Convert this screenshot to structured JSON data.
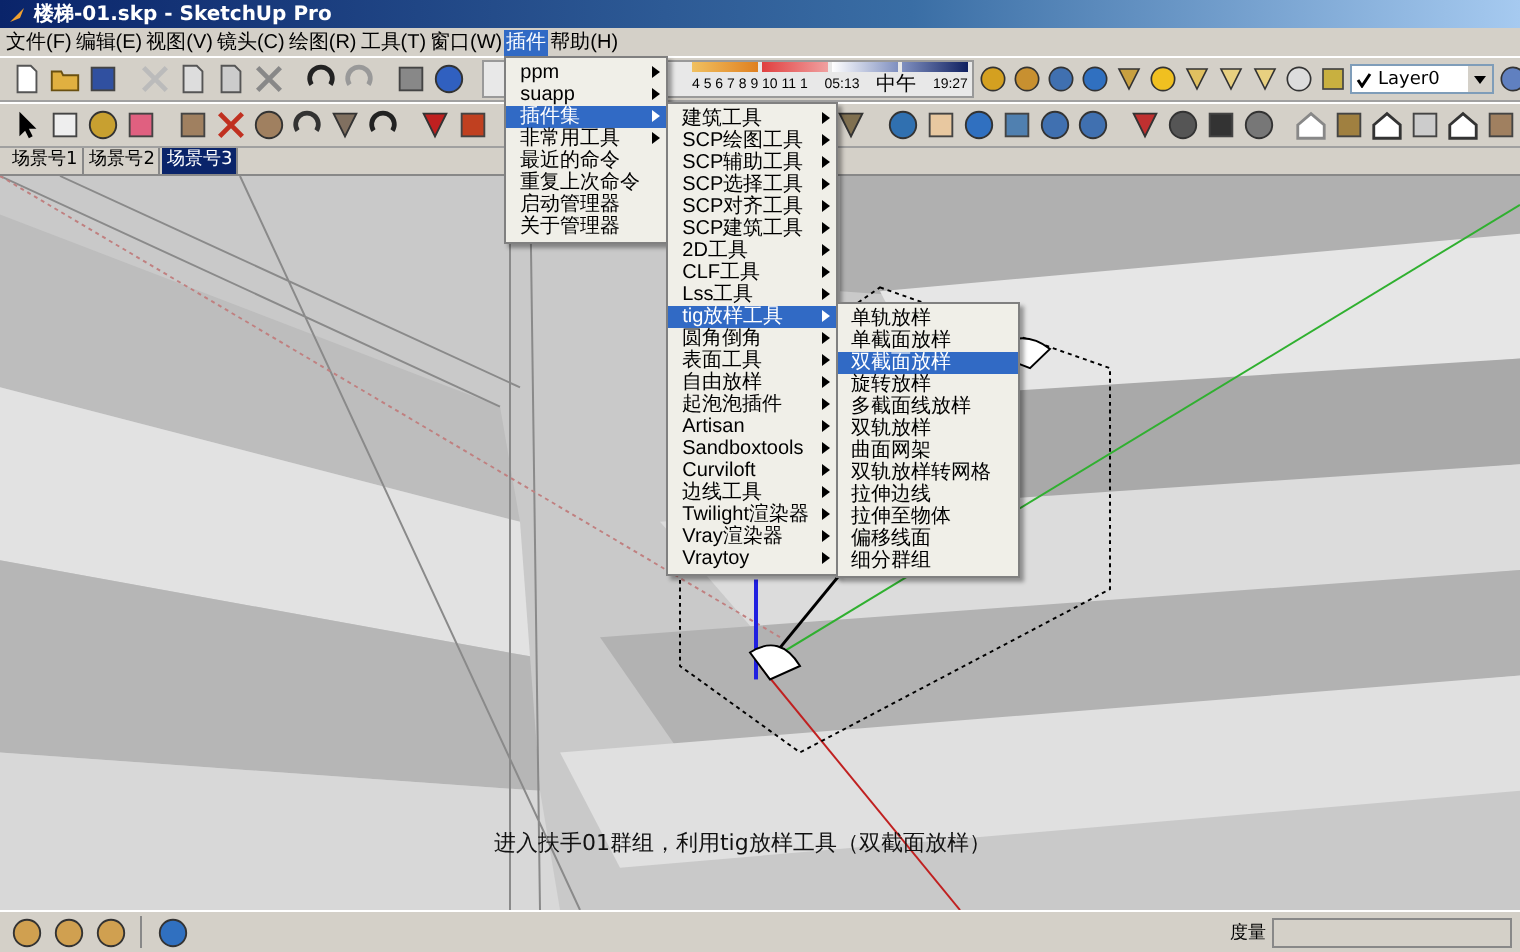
{
  "window": {
    "title": "楼梯-01.skp - SketchUp Pro"
  },
  "menu_bar": [
    {
      "label": "文件(F)",
      "selected": false
    },
    {
      "label": "编辑(E)",
      "selected": false
    },
    {
      "label": "视图(V)",
      "selected": false
    },
    {
      "label": "镜头(C)",
      "selected": false
    },
    {
      "label": "绘图(R)",
      "selected": false
    },
    {
      "label": "工具(T)",
      "selected": false
    },
    {
      "label": "窗口(W)",
      "selected": false
    },
    {
      "label": "插件",
      "selected": true
    },
    {
      "label": "帮助(H)",
      "selected": false
    }
  ],
  "shadow_bar": {
    "months": "4 5 6 7 8 9 10 11 1",
    "sunrise": "05:13",
    "noon": "中午",
    "sunset": "19:27"
  },
  "layer_select": {
    "value": "Layer0"
  },
  "scene_tabs": [
    {
      "label": "场景号1",
      "selected": false
    },
    {
      "label": "场景号2",
      "selected": false
    },
    {
      "label": "场景号3",
      "selected": true
    }
  ],
  "menus": [
    {
      "items": [
        {
          "label": "ppm",
          "submenu": true,
          "selected": false
        },
        {
          "label": "suapp",
          "submenu": true,
          "selected": false
        },
        {
          "label": "插件集",
          "submenu": true,
          "selected": true
        },
        {
          "label": "非常用工具",
          "submenu": true,
          "selected": false
        },
        {
          "label": "最近的命令",
          "submenu": false,
          "selected": false
        },
        {
          "label": "重复上次命令",
          "submenu": false,
          "selected": false
        },
        {
          "label": "启动管理器",
          "submenu": false,
          "selected": false
        },
        {
          "label": "关于管理器",
          "submenu": false,
          "selected": false
        }
      ]
    },
    {
      "items": [
        {
          "label": "建筑工具",
          "submenu": true,
          "selected": false
        },
        {
          "label": "SCP绘图工具",
          "submenu": true,
          "selected": false
        },
        {
          "label": "SCP辅助工具",
          "submenu": true,
          "selected": false
        },
        {
          "label": "SCP选择工具",
          "submenu": true,
          "selected": false
        },
        {
          "label": "SCP对齐工具",
          "submenu": true,
          "selected": false
        },
        {
          "label": "SCP建筑工具",
          "submenu": true,
          "selected": false
        },
        {
          "label": "2D工具",
          "submenu": true,
          "selected": false
        },
        {
          "label": "CLF工具",
          "submenu": true,
          "selected": false
        },
        {
          "label": "Lss工具",
          "submenu": true,
          "selected": false
        },
        {
          "label": "tig放样工具",
          "submenu": true,
          "selected": true
        },
        {
          "label": "圆角倒角",
          "submenu": true,
          "selected": false
        },
        {
          "label": "表面工具",
          "submenu": true,
          "selected": false
        },
        {
          "label": "自由放样",
          "submenu": true,
          "selected": false
        },
        {
          "label": "起泡泡插件",
          "submenu": true,
          "selected": false
        },
        {
          "label": "Artisan",
          "submenu": true,
          "selected": false
        },
        {
          "label": "Sandboxtools",
          "submenu": true,
          "selected": false
        },
        {
          "label": "Curviloft",
          "submenu": true,
          "selected": false
        },
        {
          "label": "边线工具",
          "submenu": true,
          "selected": false
        },
        {
          "label": "Twilight渲染器",
          "submenu": true,
          "selected": false
        },
        {
          "label": "Vray渲染器",
          "submenu": true,
          "selected": false
        },
        {
          "label": "Vraytoy",
          "submenu": true,
          "selected": false
        }
      ]
    },
    {
      "items": [
        {
          "label": "单轨放样",
          "submenu": false,
          "selected": false
        },
        {
          "label": "单截面放样",
          "submenu": false,
          "selected": false
        },
        {
          "label": "双截面放样",
          "submenu": false,
          "selected": true
        },
        {
          "label": "旋转放样",
          "submenu": false,
          "selected": false
        },
        {
          "label": "多截面线放样",
          "submenu": false,
          "selected": false
        },
        {
          "label": "双轨放样",
          "submenu": false,
          "selected": false
        },
        {
          "label": "曲面网架",
          "submenu": false,
          "selected": false
        },
        {
          "label": "双轨放样转网格",
          "submenu": false,
          "selected": false
        },
        {
          "label": "拉伸边线",
          "submenu": false,
          "selected": false
        },
        {
          "label": "拉伸至物体",
          "submenu": false,
          "selected": false
        },
        {
          "label": "偏移线面",
          "submenu": false,
          "selected": false
        },
        {
          "label": "细分群组",
          "submenu": false,
          "selected": false
        }
      ]
    }
  ],
  "caption": "进入扶手01群组，利用tig放样工具（双截面放样）",
  "status_bar": {
    "measure_label": "度量"
  }
}
